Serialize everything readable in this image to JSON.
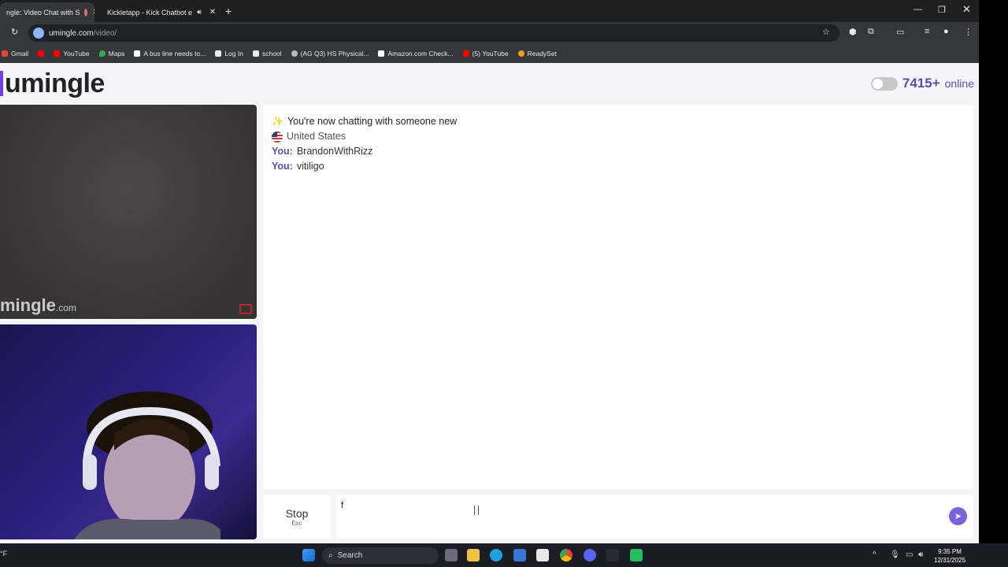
{
  "browser": {
    "tabs": [
      {
        "label": "ngle: Video Chat with S",
        "active": true
      },
      {
        "label": "Kickletapp - Kick Chatbot e",
        "active": false
      }
    ],
    "url_host": "umingle.com",
    "url_path": "/video/",
    "bookmarks": [
      {
        "label": "Gmail",
        "icon": "gmail-icon"
      },
      {
        "label": "",
        "icon": "youtube-icon"
      },
      {
        "label": "YouTube",
        "icon": "youtube-icon"
      },
      {
        "label": "Maps",
        "icon": "maps-icon"
      },
      {
        "label": "A bus line needs to...",
        "icon": "bookmark-icon"
      },
      {
        "label": "Log In",
        "icon": "bookmark-icon"
      },
      {
        "label": "school",
        "icon": "bookmark-icon"
      },
      {
        "label": "(AG Q3) HS Physical...",
        "icon": "bookmark-icon"
      },
      {
        "label": "Amazon.com Check...",
        "icon": "amazon-icon"
      },
      {
        "label": "(5) YouTube",
        "icon": "youtube-icon"
      },
      {
        "label": "ReadySet",
        "icon": "readyset-icon"
      }
    ]
  },
  "site": {
    "logo": "umingle",
    "online_count": "7415+",
    "online_label": "online",
    "watermark": "mingle",
    "watermark_suffix": ".com"
  },
  "chat": {
    "system_message": "You're now chatting with someone new",
    "country": "United States",
    "messages": [
      {
        "sender": "You:",
        "text": "BrandonWithRizz"
      },
      {
        "sender": "You:",
        "text": "vitiligo"
      }
    ]
  },
  "controls": {
    "stop_label": "Stop",
    "stop_key": "Esc",
    "input_value": "f"
  },
  "taskbar": {
    "search_label": "Search",
    "time": "9:35 PM",
    "date": "12/31/2025",
    "weather": "°F"
  },
  "colors": {
    "accent": "#5b4bb7",
    "page_bg": "#f5f5f7",
    "chrome_bg": "#35363a"
  }
}
